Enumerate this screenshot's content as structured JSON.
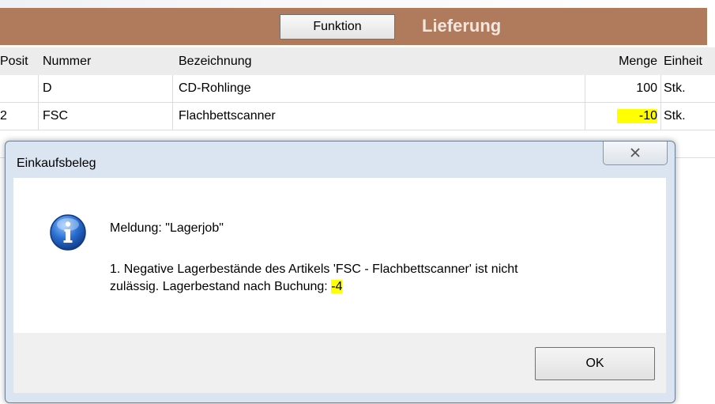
{
  "toolbar": {
    "function_button_label": "Funktion",
    "title": "Lieferung",
    "background_color": "#b07a5c"
  },
  "grid": {
    "headers": [
      "Posit",
      "Nummer",
      "Bezeichnung",
      "Menge",
      "Einheit"
    ],
    "rows": [
      {
        "pos": "",
        "nummer": "D",
        "bezeichnung": "CD-Rohlinge",
        "menge": "100",
        "einheit": "Stk."
      },
      {
        "pos": "2",
        "nummer": "FSC",
        "bezeichnung": "Flachbettscanner",
        "menge": "-10",
        "einheit": "Stk."
      }
    ],
    "highlight_color": "#ffff00"
  },
  "dialog": {
    "title": "Einkaufsbeleg",
    "close_icon": "close-icon",
    "icon": "info-icon",
    "message_title": "Meldung: \"Lagerjob\"",
    "message_line_1": "1. Negative Lagerbestände des Artikels 'FSC - Flachbettscanner' ist nicht",
    "message_line_2_prefix": "zulässig. Lagerbestand nach Buchung: ",
    "message_value": "-4",
    "ok_label": "OK"
  }
}
